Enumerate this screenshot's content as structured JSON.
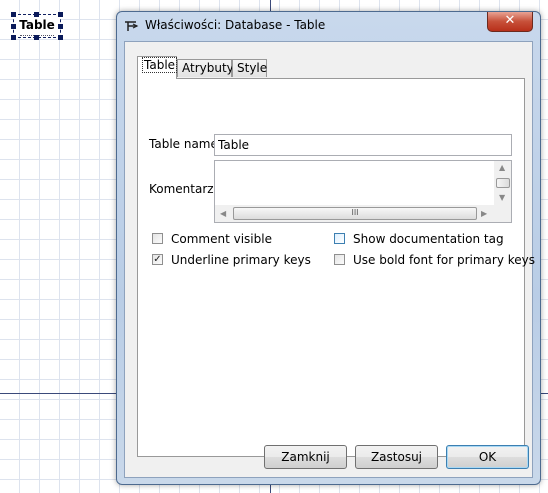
{
  "canvas": {
    "table_label": "Table"
  },
  "dialog": {
    "title": "Właściwości: Database - Table",
    "close_glyph": "✕",
    "tabs": [
      "Table",
      "Atrybuty",
      "Style"
    ],
    "fields": {
      "table_name_label": "Table name:",
      "table_name_value": "Table",
      "comment_label": "Komentarz:",
      "comment_value": "",
      "hscroll_grip": "III"
    },
    "checkboxes": {
      "comment_visible": {
        "label": "Comment visible",
        "checked": false
      },
      "show_doc_tag": {
        "label": "Show documentation tag",
        "checked": false
      },
      "underline_pk": {
        "label": "Underline primary keys",
        "checked": true
      },
      "bold_pk": {
        "label": "Use bold font for primary keys",
        "checked": false
      }
    },
    "buttons": {
      "close": "Zamknij",
      "apply": "Zastosuj",
      "ok": "OK"
    }
  },
  "colors": {
    "accent": "#3c7fb1",
    "close": "#c75039",
    "axis": "#3b4a7a"
  }
}
